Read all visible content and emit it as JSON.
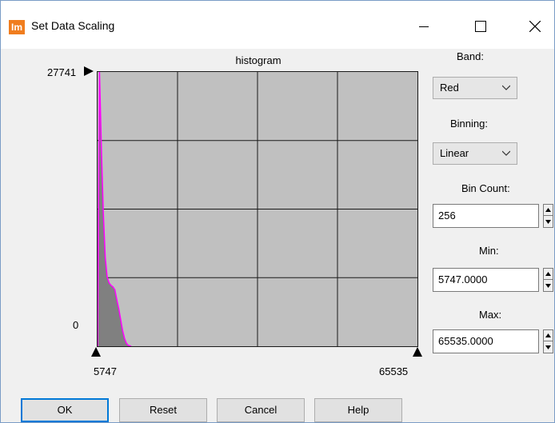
{
  "window": {
    "title": "Set Data Scaling",
    "app_icon_text": "Im",
    "minimize_icon": "minimize-icon",
    "maximize_icon": "maximize-icon",
    "close_icon": "close-icon"
  },
  "histogram": {
    "title": "histogram",
    "y_max": "27741",
    "y_min": "0",
    "x_min": "5747",
    "x_max": "65535",
    "line_color": "#ff00ff",
    "fill_color": "#808080",
    "background_color": "#c0c0c0"
  },
  "chart_data": {
    "type": "area",
    "title": "histogram",
    "xlabel": "",
    "ylabel": "",
    "xlim": [
      5747,
      65535
    ],
    "ylim": [
      0,
      27741
    ],
    "grid": true,
    "x": [
      5747,
      6107,
      6467,
      6827,
      7187,
      7547,
      7907,
      8267,
      8627,
      8987,
      9347,
      9707,
      10067,
      10427,
      10787,
      11147,
      11507,
      12000
    ],
    "values": [
      0,
      27741,
      20000,
      13500,
      9000,
      7000,
      6400,
      6150,
      6000,
      5700,
      4700,
      3800,
      2700,
      1600,
      800,
      300,
      80,
      0
    ]
  },
  "sidebar": {
    "band_label": "Band:",
    "band_value": "Red",
    "binning_label": "Binning:",
    "binning_value": "Linear",
    "bin_count_label": "Bin Count:",
    "bin_count_value": "256",
    "min_label": "Min:",
    "min_value": "5747.0000",
    "max_label": "Max:",
    "max_value": "65535.0000"
  },
  "buttons": {
    "ok": "OK",
    "reset": "Reset",
    "cancel": "Cancel",
    "help": "Help"
  }
}
